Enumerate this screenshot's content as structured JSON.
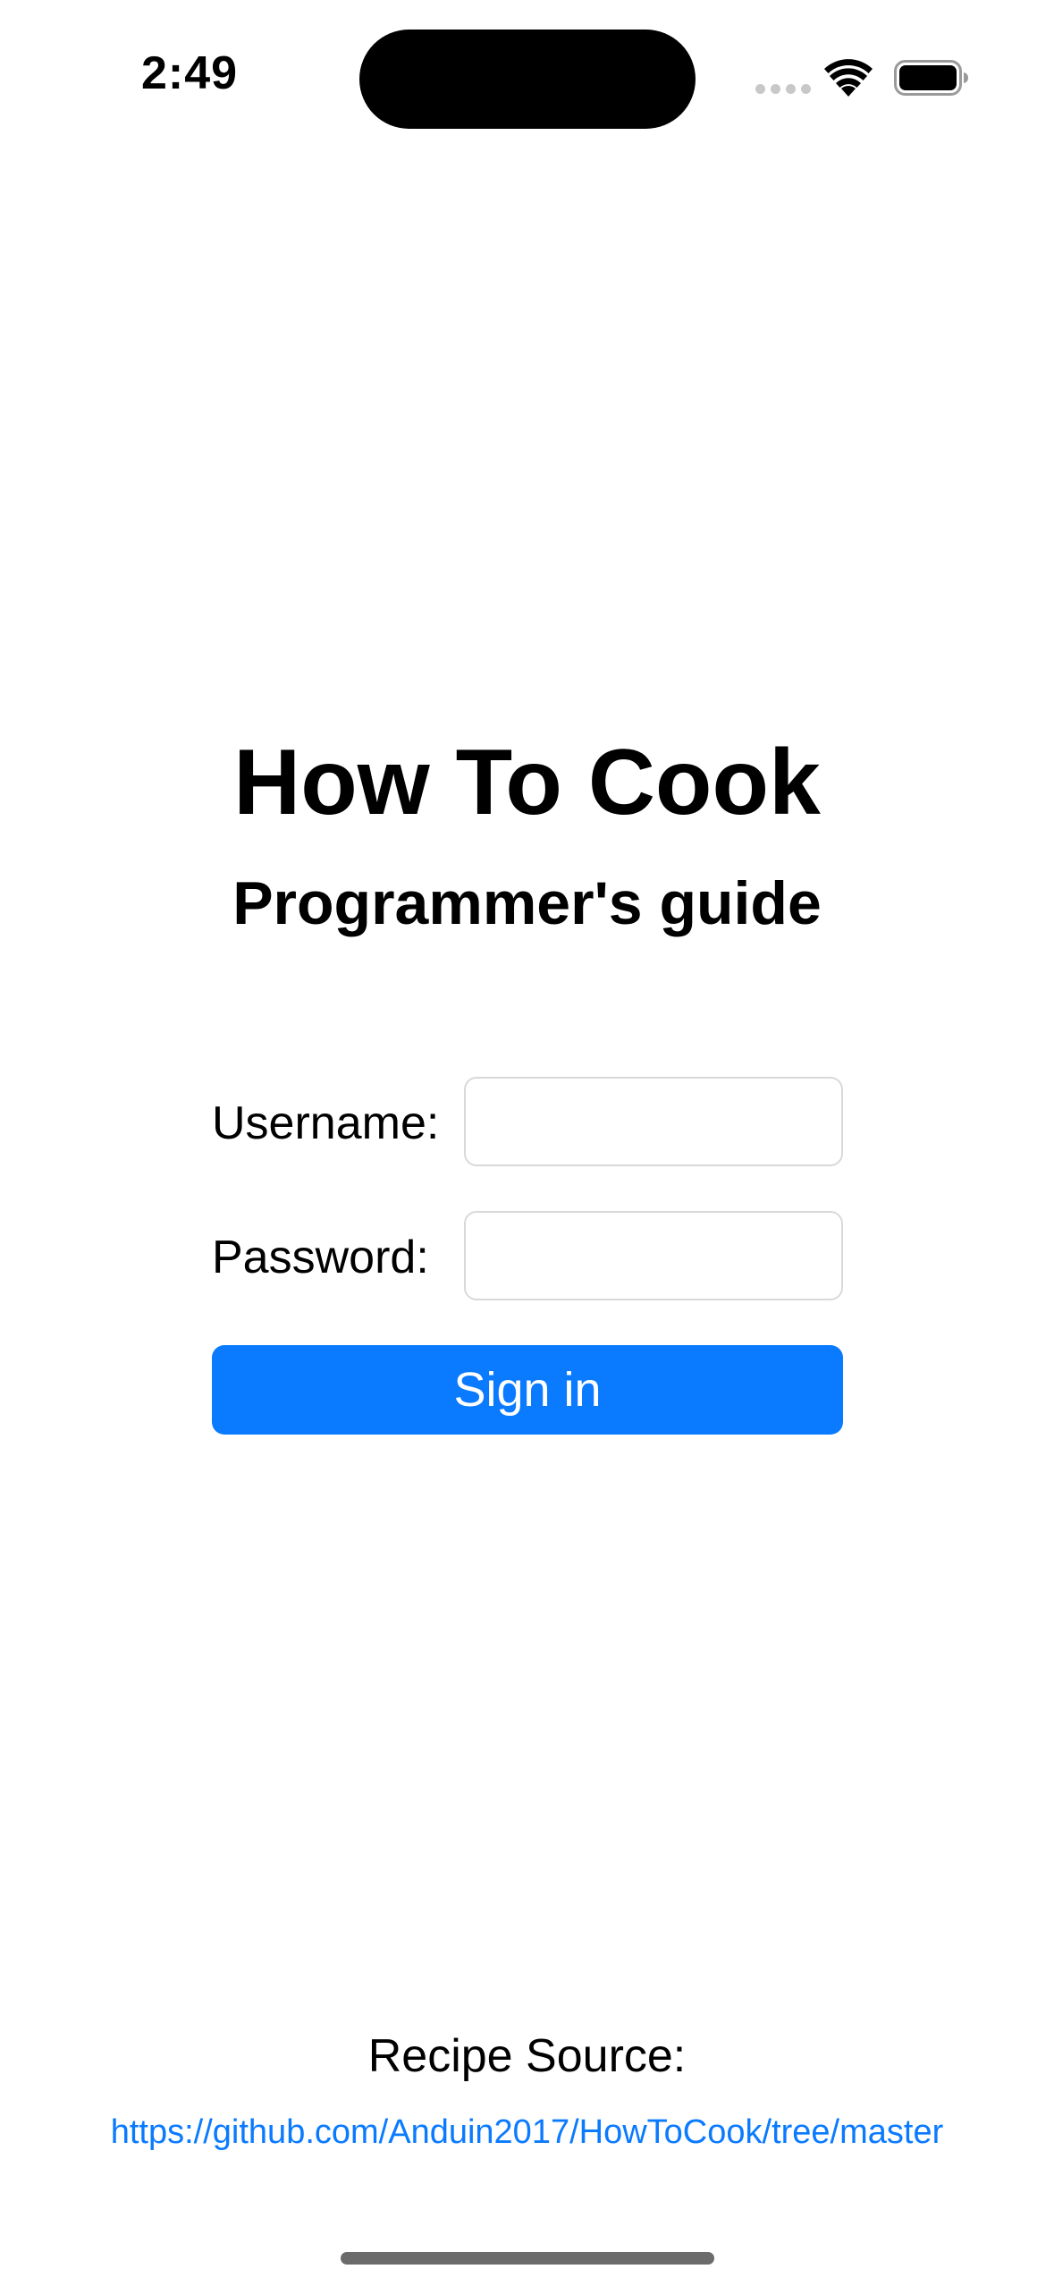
{
  "status_bar": {
    "time": "2:49",
    "icons": [
      "signal-icon",
      "wifi-icon",
      "battery-icon"
    ]
  },
  "header": {
    "title": "How To Cook",
    "subtitle": "Programmer's guide"
  },
  "form": {
    "username_label": "Username:",
    "username_value": "",
    "password_label": "Password:",
    "password_value": "",
    "signin_label": "Sign in"
  },
  "footer": {
    "source_label": "Recipe Source:",
    "source_url": "https://github.com/Anduin2017/HowToCook/tree/master"
  },
  "colors": {
    "accent": "#0a7aff",
    "text": "#000000",
    "background": "#ffffff"
  }
}
